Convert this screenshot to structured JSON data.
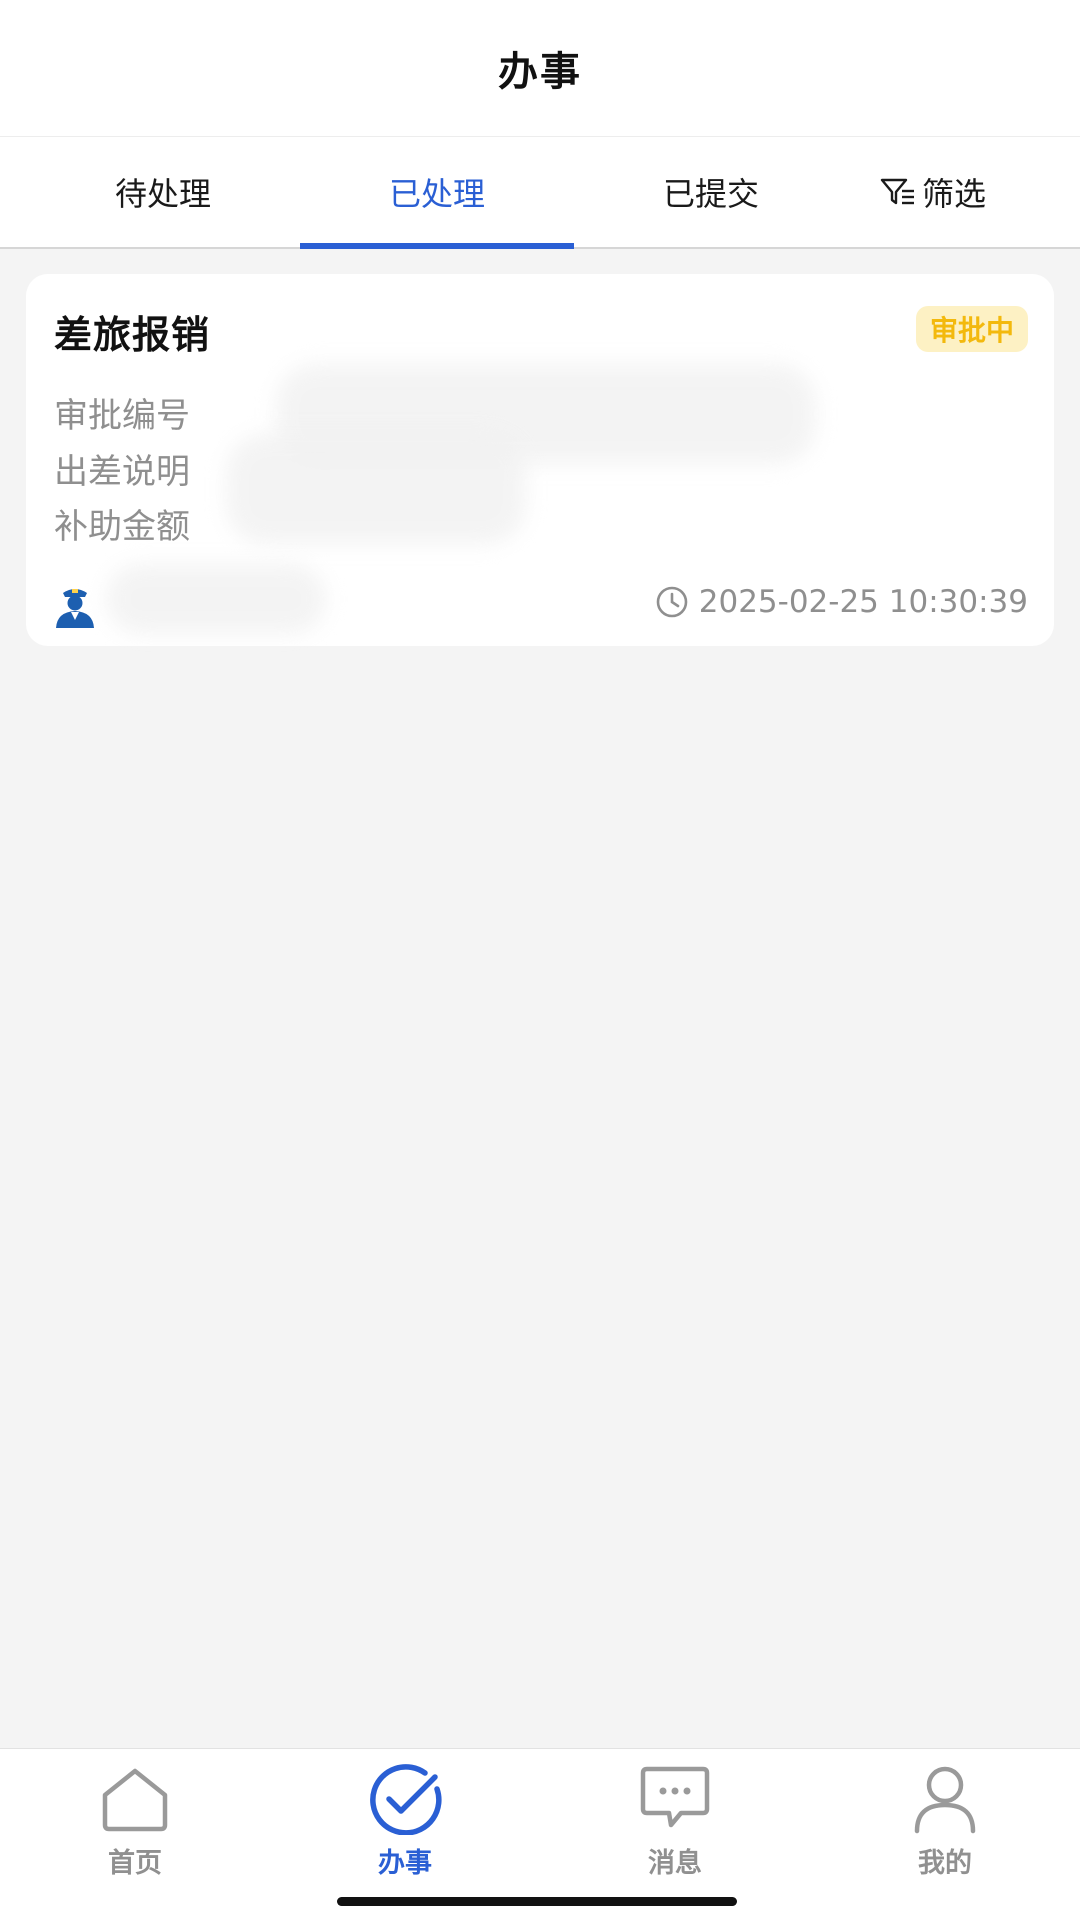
{
  "header": {
    "title": "办事"
  },
  "tabs": [
    {
      "label": "待处理"
    },
    {
      "label": "已处理"
    },
    {
      "label": "已提交"
    }
  ],
  "filter": {
    "label": "筛选",
    "icon": "filter-icon"
  },
  "active_tab": "已处理",
  "card": {
    "title": "差旅报销",
    "status": "审批中",
    "fields": [
      "审批编号",
      "出差说明",
      "补助金额"
    ],
    "avatar_icon": "police-officer-icon",
    "timestamp": "2025-02-25 10:30:39"
  },
  "bottom_nav": [
    {
      "label": "首页",
      "icon": "home-icon"
    },
    {
      "label": "办事",
      "icon": "check-circle-icon"
    },
    {
      "label": "消息",
      "icon": "chat-icon"
    },
    {
      "label": "我的",
      "icon": "user-icon"
    }
  ],
  "colors": {
    "accent": "#2a5fd4",
    "badge_bg": "#fdf1c4",
    "badge_text": "#f3b90d",
    "muted_text": "#8f8f8f",
    "page_bg": "#f4f4f4"
  }
}
